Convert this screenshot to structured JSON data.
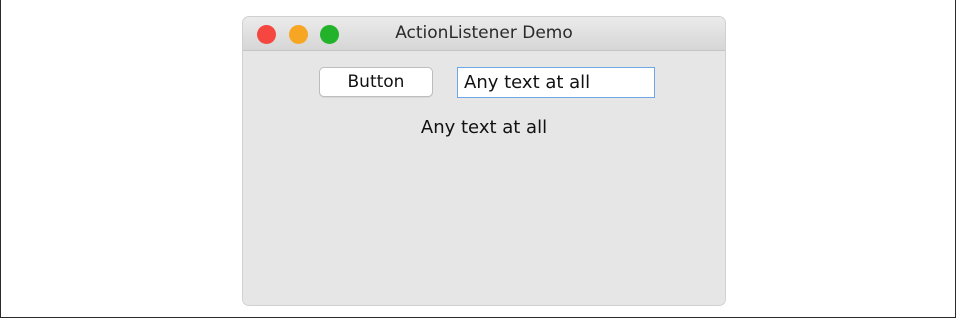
{
  "window": {
    "title": "ActionListener Demo"
  },
  "controls": {
    "button_label": "Button",
    "text_field_value": "Any text at all"
  },
  "output": {
    "label_text": "Any text at all"
  },
  "icons": {
    "close": "close-traffic-light-icon",
    "minimize": "minimize-traffic-light-icon",
    "zoom": "zoom-traffic-light-icon"
  },
  "colors": {
    "close": "#f5463f",
    "minimize": "#f6a623",
    "zoom": "#22b32b",
    "focus_ring": "#6fa6e6",
    "window_background": "#e6e6e6"
  }
}
